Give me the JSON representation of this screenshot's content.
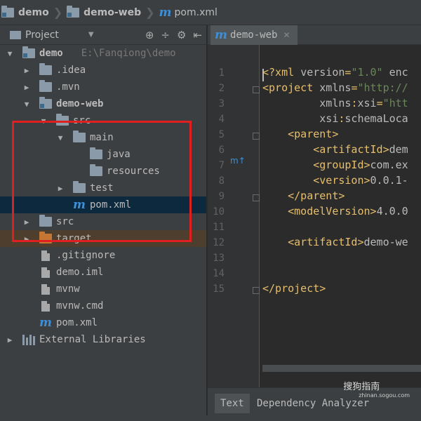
{
  "breadcrumb": {
    "items": [
      "demo",
      "demo-web",
      "pom.xml"
    ]
  },
  "panel": {
    "title": "Project"
  },
  "tree": [
    {
      "label": "demo",
      "path": "E:\\Fanqiong\\demo",
      "indent": 0,
      "arrow": "down",
      "icon": "module-folder",
      "bold": true
    },
    {
      "label": ".idea",
      "indent": 1,
      "arrow": "right",
      "icon": "folder"
    },
    {
      "label": ".mvn",
      "indent": 1,
      "arrow": "right",
      "icon": "folder"
    },
    {
      "label": "demo-web",
      "indent": 1,
      "arrow": "down",
      "icon": "module-folder",
      "bold": true
    },
    {
      "label": "src",
      "indent": 2,
      "arrow": "down",
      "icon": "folder"
    },
    {
      "label": "main",
      "indent": 3,
      "arrow": "down",
      "icon": "folder"
    },
    {
      "label": "java",
      "indent": 4,
      "arrow": "none",
      "icon": "folder"
    },
    {
      "label": "resources",
      "indent": 4,
      "arrow": "none",
      "icon": "folder"
    },
    {
      "label": "test",
      "indent": 3,
      "arrow": "right",
      "icon": "folder"
    },
    {
      "label": "pom.xml",
      "indent": 3,
      "arrow": "none",
      "icon": "maven",
      "selected": true
    },
    {
      "label": "src",
      "indent": 1,
      "arrow": "right",
      "icon": "folder"
    },
    {
      "label": "target",
      "indent": 1,
      "arrow": "right",
      "icon": "orange-folder",
      "highlight": "orange"
    },
    {
      "label": ".gitignore",
      "indent": 1,
      "arrow": "none",
      "icon": "file"
    },
    {
      "label": "demo.iml",
      "indent": 1,
      "arrow": "none",
      "icon": "file"
    },
    {
      "label": "mvnw",
      "indent": 1,
      "arrow": "none",
      "icon": "file"
    },
    {
      "label": "mvnw.cmd",
      "indent": 1,
      "arrow": "none",
      "icon": "file"
    },
    {
      "label": "pom.xml",
      "indent": 1,
      "arrow": "none",
      "icon": "maven"
    },
    {
      "label": "External Libraries",
      "indent": 0,
      "arrow": "right",
      "icon": "libraries"
    }
  ],
  "editor": {
    "tab_label": "demo-web",
    "line_numbers": [
      "1",
      "2",
      "3",
      "4",
      "5",
      "6",
      "7",
      "8",
      "9",
      "10",
      "11",
      "12",
      "13",
      "14",
      "15"
    ],
    "lines": [
      [
        [
          "tag",
          "<?xml "
        ],
        [
          "at",
          "version"
        ],
        [
          "tag",
          "="
        ],
        [
          "av",
          "\"1.0\" "
        ],
        [
          "at",
          "enc"
        ]
      ],
      [
        [
          "tag",
          "<project "
        ],
        [
          "at",
          "xmlns"
        ],
        [
          "tag",
          "="
        ],
        [
          "av",
          "\"http://"
        ]
      ],
      [
        [
          "tx",
          "         "
        ],
        [
          "at",
          "xmlns"
        ],
        [
          "tag",
          ":"
        ],
        [
          "at",
          "xsi"
        ],
        [
          "tag",
          "="
        ],
        [
          "av",
          "\"htt"
        ]
      ],
      [
        [
          "tx",
          "         "
        ],
        [
          "at",
          "xsi"
        ],
        [
          "tag",
          ":"
        ],
        [
          "at",
          "schemaLoca"
        ]
      ],
      [
        [
          "tag",
          "    <parent>"
        ]
      ],
      [
        [
          "tag",
          "        <artifactId>"
        ],
        [
          "tx",
          "dem"
        ]
      ],
      [
        [
          "tag",
          "        <groupId>"
        ],
        [
          "tx",
          "com.ex"
        ]
      ],
      [
        [
          "tag",
          "        <version>"
        ],
        [
          "tx",
          "0.0.1-"
        ]
      ],
      [
        [
          "tag",
          "    </parent>"
        ]
      ],
      [
        [
          "tag",
          "    <modelVersion>"
        ],
        [
          "tx",
          "4.0.0"
        ]
      ],
      [
        [
          "tx",
          ""
        ]
      ],
      [
        [
          "tag",
          "    <artifactId>"
        ],
        [
          "tx",
          "demo-we"
        ]
      ],
      [
        [
          "tx",
          ""
        ]
      ],
      [
        [
          "tx",
          ""
        ]
      ],
      [
        [
          "tag",
          "</project>"
        ]
      ]
    ]
  },
  "bottom_tabs": [
    "Text",
    "Dependency Analyzer"
  ],
  "watermark": {
    "text": "搜狗指南",
    "sub": "zhinan.sogou.com"
  }
}
